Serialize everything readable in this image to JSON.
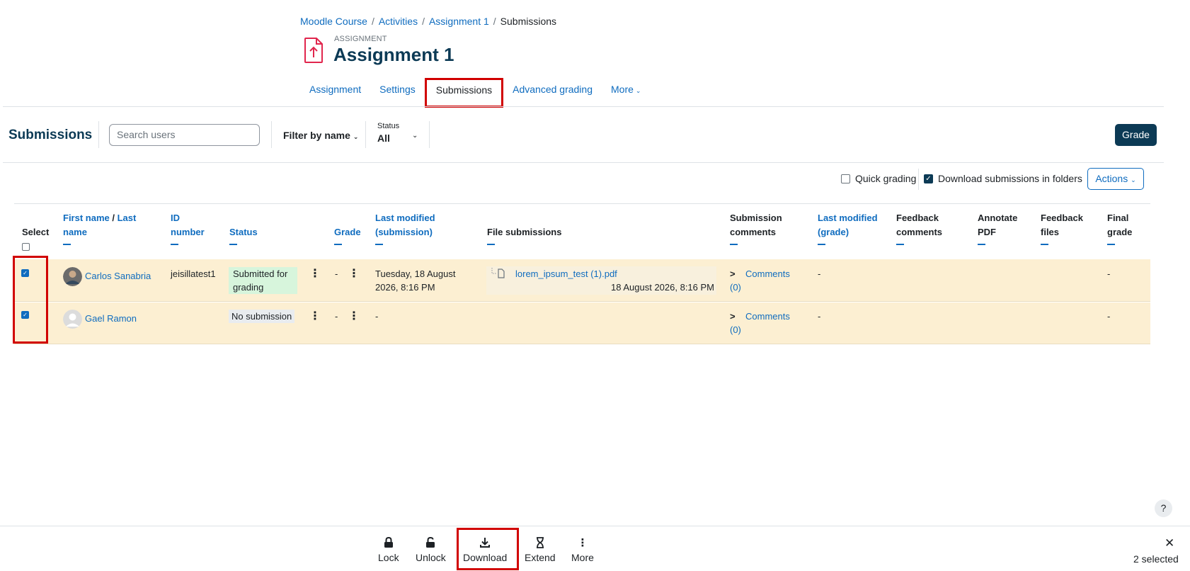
{
  "breadcrumb": [
    "Moodle Course",
    "Activities",
    "Assignment 1",
    "Submissions"
  ],
  "activity": {
    "kind": "ASSIGNMENT",
    "title": "Assignment 1"
  },
  "tabs": [
    {
      "label": "Assignment"
    },
    {
      "label": "Settings"
    },
    {
      "label": "Submissions"
    },
    {
      "label": "Advanced grading"
    },
    {
      "label": "More"
    }
  ],
  "toolbar": {
    "title": "Submissions",
    "search_placeholder": "Search users",
    "filter_label": "Filter by name",
    "status_label": "Status",
    "status_value": "All",
    "grade_label": "Grade"
  },
  "options": {
    "quick_grading": "Quick grading",
    "download_folders": "Download submissions in folders",
    "actions": "Actions"
  },
  "table": {
    "headers": {
      "select": "Select",
      "first_name": "First name",
      "slash": " / ",
      "last_name": "Last name",
      "id": "ID number",
      "status": "Status",
      "grade": "Grade",
      "last_modified_sub": "Last modified (submission)",
      "file_submissions": "File submissions",
      "sub_comments": "Submission comments",
      "last_modified_grade": "Last modified (grade)",
      "feedback_comments": "Feedback comments",
      "annotate_pdf": "Annotate PDF",
      "feedback_files": "Feedback files",
      "final_grade": "Final grade"
    },
    "rows": [
      {
        "name": "Carlos Sanabria",
        "id": "jeisillatest1",
        "status": "Submitted for grading",
        "grade": "-",
        "last_modified": "Tuesday, 18 August 2026, 8:16 PM",
        "file_name": "lorem_ipsum_test (1).pdf",
        "file_date": "18 August 2026, 8:16 PM",
        "comments": "Comments",
        "comments_count": "(0)",
        "grade_modified": "-",
        "final_grade": "-"
      },
      {
        "name": "Gael Ramon",
        "id": "",
        "status": "No submission",
        "grade": "-",
        "last_modified": "-",
        "comments": "Comments",
        "comments_count": "(0)",
        "grade_modified": "-",
        "final_grade": "-"
      }
    ]
  },
  "bulk": {
    "lock": "Lock",
    "unlock": "Unlock",
    "download": "Download",
    "extend": "Extend",
    "more": "More",
    "selected": "2 selected",
    "help": "?"
  },
  "colors": {
    "link": "#0f6cbf",
    "heading": "#0c3a55",
    "row_bg": "#fcefd2",
    "highlight": "#d10000"
  }
}
